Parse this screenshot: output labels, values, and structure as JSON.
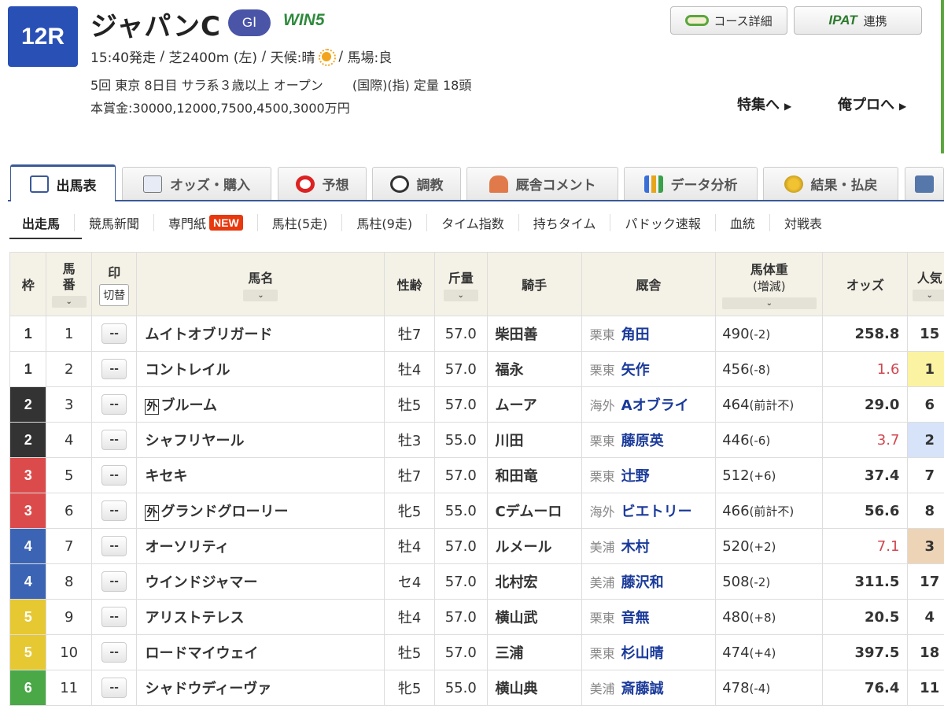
{
  "race": {
    "number": "12R",
    "name": "ジャパンC",
    "grade": "GⅠ",
    "win5": "WIN5",
    "start_time": "15:40発走",
    "course": "芝2400m (左)",
    "weather_label": "天候:晴",
    "track": "馬場:良",
    "details": "5回 東京 8日目 サラ系３歳以上 オープン　　 (国際)(指) 定量 18頭",
    "prize": "本賞金:30000,12000,7500,4500,3000万円"
  },
  "header_buttons": {
    "course": "コース詳細",
    "ipat_logo": "IPAT",
    "ipat_label": "連携"
  },
  "links": {
    "special": "特集へ",
    "blog": "俺プロへ"
  },
  "main_tabs": [
    "出馬表",
    "オッズ・購入",
    "予想",
    "調教",
    "厩舎コメント",
    "データ分析",
    "結果・払戻"
  ],
  "sub_tabs": [
    "出走馬",
    "競馬新聞",
    "専門紙",
    "馬柱(5走)",
    "馬柱(9走)",
    "タイム指数",
    "持ちタイム",
    "パドック速報",
    "血統",
    "対戦表"
  ],
  "new_badge": "NEW",
  "columns": {
    "waku": "枠",
    "umaban": "馬番",
    "mark": "印",
    "mark_toggle": "切替",
    "horse": "馬名",
    "sexage": "性齢",
    "kinryo": "斤量",
    "jockey": "騎手",
    "trainer": "厩舎",
    "weight": "馬体重",
    "weight_sub": "(増減)",
    "odds": "オッズ",
    "ninki": "人気"
  },
  "mark_placeholder": "--",
  "foreign_mark": "外",
  "colors": {
    "waku": {
      "1": "#ffffff",
      "2": "#333333",
      "3": "#dc4b4b",
      "4": "#3c64b4",
      "5": "#e6c832",
      "6": "#4aa847"
    },
    "waku_text": {
      "1": "#333333",
      "2": "#ffffff",
      "3": "#ffffff",
      "4": "#ffffff",
      "5": "#ffffff",
      "6": "#ffffff"
    },
    "ninki": {
      "1": "#fbf3a1",
      "2": "#d7e3f8",
      "3": "#edd4b7"
    }
  },
  "horses": [
    {
      "waku": "1",
      "umaban": "1",
      "name": "ムイトオブリガード",
      "foreign": false,
      "sexage": "牡7",
      "kinryo": "57.0",
      "jockey": "柴田善",
      "region": "栗東",
      "trainer": "角田",
      "weight": "490",
      "change": "(-2)",
      "odds": "258.8",
      "hot": false,
      "ninki": "15"
    },
    {
      "waku": "1",
      "umaban": "2",
      "name": "コントレイル",
      "foreign": false,
      "sexage": "牡4",
      "kinryo": "57.0",
      "jockey": "福永",
      "region": "栗東",
      "trainer": "矢作",
      "weight": "456",
      "change": "(-8)",
      "odds": "1.6",
      "hot": true,
      "ninki": "1"
    },
    {
      "waku": "2",
      "umaban": "3",
      "name": "ブルーム",
      "foreign": true,
      "sexage": "牡5",
      "kinryo": "57.0",
      "jockey": "ムーア",
      "region": "海外",
      "trainer": "Aオブライ",
      "weight": "464",
      "change": "(前計不)",
      "odds": "29.0",
      "hot": false,
      "ninki": "6"
    },
    {
      "waku": "2",
      "umaban": "4",
      "name": "シャフリヤール",
      "foreign": false,
      "sexage": "牡3",
      "kinryo": "55.0",
      "jockey": "川田",
      "region": "栗東",
      "trainer": "藤原英",
      "weight": "446",
      "change": "(-6)",
      "odds": "3.7",
      "hot": true,
      "ninki": "2"
    },
    {
      "waku": "3",
      "umaban": "5",
      "name": "キセキ",
      "foreign": false,
      "sexage": "牡7",
      "kinryo": "57.0",
      "jockey": "和田竜",
      "region": "栗東",
      "trainer": "辻野",
      "weight": "512",
      "change": "(+6)",
      "odds": "37.4",
      "hot": false,
      "ninki": "7"
    },
    {
      "waku": "3",
      "umaban": "6",
      "name": "グランドグローリー",
      "foreign": true,
      "sexage": "牝5",
      "kinryo": "55.0",
      "jockey": "Cデムーロ",
      "region": "海外",
      "trainer": "ビエトリー",
      "weight": "466",
      "change": "(前計不)",
      "odds": "56.6",
      "hot": false,
      "ninki": "8"
    },
    {
      "waku": "4",
      "umaban": "7",
      "name": "オーソリティ",
      "foreign": false,
      "sexage": "牡4",
      "kinryo": "57.0",
      "jockey": "ルメール",
      "region": "美浦",
      "trainer": "木村",
      "weight": "520",
      "change": "(+2)",
      "odds": "7.1",
      "hot": true,
      "ninki": "3"
    },
    {
      "waku": "4",
      "umaban": "8",
      "name": "ウインドジャマー",
      "foreign": false,
      "sexage": "セ4",
      "kinryo": "57.0",
      "jockey": "北村宏",
      "region": "美浦",
      "trainer": "藤沢和",
      "weight": "508",
      "change": "(-2)",
      "odds": "311.5",
      "hot": false,
      "ninki": "17"
    },
    {
      "waku": "5",
      "umaban": "9",
      "name": "アリストテレス",
      "foreign": false,
      "sexage": "牡4",
      "kinryo": "57.0",
      "jockey": "横山武",
      "region": "栗東",
      "trainer": "音無",
      "weight": "480",
      "change": "(+8)",
      "odds": "20.5",
      "hot": false,
      "ninki": "4"
    },
    {
      "waku": "5",
      "umaban": "10",
      "name": "ロードマイウェイ",
      "foreign": false,
      "sexage": "牡5",
      "kinryo": "57.0",
      "jockey": "三浦",
      "region": "栗東",
      "trainer": "杉山晴",
      "weight": "474",
      "change": "(+4)",
      "odds": "397.5",
      "hot": false,
      "ninki": "18"
    },
    {
      "waku": "6",
      "umaban": "11",
      "name": "シャドウディーヴァ",
      "foreign": false,
      "sexage": "牝5",
      "kinryo": "55.0",
      "jockey": "横山典",
      "region": "美浦",
      "trainer": "斎藤誠",
      "weight": "478",
      "change": "(-4)",
      "odds": "76.4",
      "hot": false,
      "ninki": "11"
    }
  ]
}
